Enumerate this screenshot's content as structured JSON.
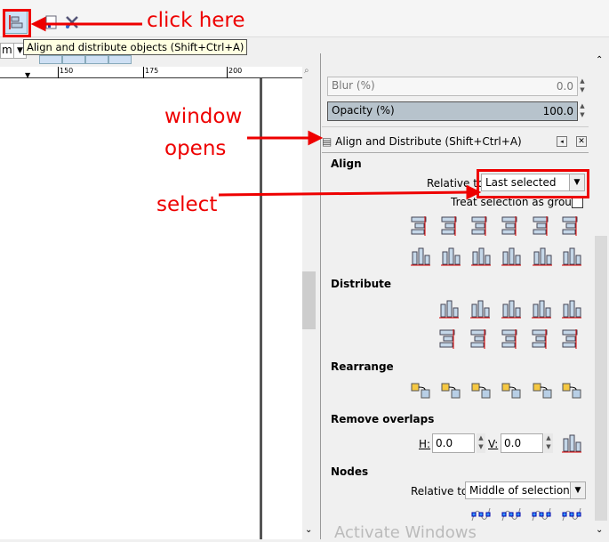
{
  "toolbar": {
    "tooltip": "Align and distribute objects (Shift+Ctrl+A)",
    "unit": "m"
  },
  "ruler": {
    "labels": [
      "150",
      "175",
      "200"
    ]
  },
  "panel": {
    "blur": {
      "label": "Blur (%)",
      "value": "0.0"
    },
    "opacity": {
      "label": "Opacity (%)",
      "value": "100.0"
    },
    "dialog_title": "Align and Distribute (Shift+Ctrl+A)",
    "align": {
      "heading": "Align",
      "relative_label": "Relative to",
      "relative_value": "Last selected",
      "group_label": "Treat selection as group:",
      "group_checked": false
    },
    "distribute": {
      "heading": "Distribute"
    },
    "rearrange": {
      "heading": "Rearrange"
    },
    "overlaps": {
      "heading": "Remove overlaps",
      "h_label": "H:",
      "h_value": "0.0",
      "v_label": "V:",
      "v_value": "0.0"
    },
    "nodes": {
      "heading": "Nodes",
      "relative_label": "Relative to:",
      "relative_value": "Middle of selection"
    }
  },
  "annotations": {
    "click": "click here",
    "window1": "window",
    "window2": "opens",
    "select": "select",
    "color": "#ee0000"
  },
  "watermark": "Activate Windows"
}
